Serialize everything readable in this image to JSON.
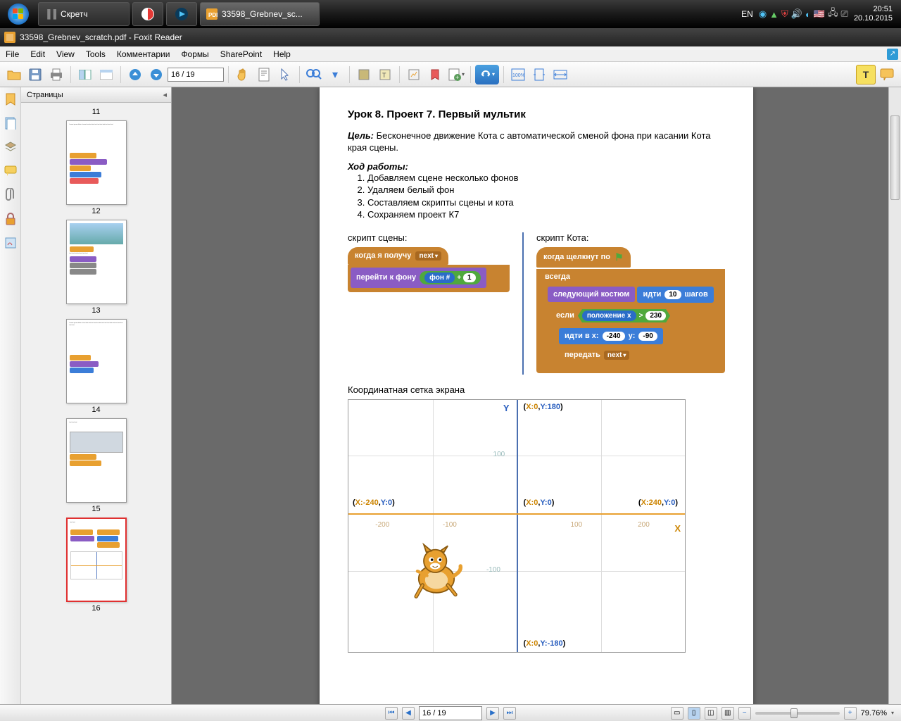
{
  "taskbar": {
    "items": [
      {
        "label": "Скретч"
      },
      {
        "label": ""
      },
      {
        "label": ""
      },
      {
        "label": "33598_Grebnev_sc..."
      }
    ],
    "lang": "EN",
    "time": "20:51",
    "date": "20.10.2015"
  },
  "window": {
    "title": "33598_Grebnev_scratch.pdf - Foxit Reader"
  },
  "menu": {
    "file": "File",
    "edit": "Edit",
    "view": "View",
    "tools": "Tools",
    "comments": "Комментарии",
    "forms": "Формы",
    "sharepoint": "SharePoint",
    "help": "Help"
  },
  "toolbar": {
    "page_top": "16 / 19",
    "page_bottom": "16 / 19"
  },
  "sidebar": {
    "header": "Страницы",
    "thumbs": [
      {
        "n": "11"
      },
      {
        "n": "12"
      },
      {
        "n": "13"
      },
      {
        "n": "14"
      },
      {
        "n": "15"
      },
      {
        "n": "16"
      }
    ]
  },
  "doc": {
    "title": "Урок 8. Проект 7. Первый мультик",
    "goal_label": "Цель:",
    "goal_text": "Бесконечное движение Кота с автоматической сменой фона при касании Кота края сцены.",
    "steps_label": "Ход работы:",
    "steps": [
      "Добавляем сцене несколько фонов",
      "Удаляем белый фон",
      "Составляем скрипты сцены и кота",
      "Сохраняем проект К7"
    ],
    "scene_label": "скрипт сцены:",
    "cat_label": "скрипт Кота:",
    "grid_label": "Координатная сетка экрана",
    "blocks": {
      "when_receive": "когда я получу",
      "next": "next",
      "goto_bg": "перейти к фону",
      "bg_num": "фон #",
      "plus": "+",
      "one": "1",
      "when_flag": "когда щелкнут по",
      "forever": "всегда",
      "next_costume": "следующий костюм",
      "move": "идти",
      "ten": "10",
      "steps_w": "шагов",
      "if": "если",
      "xpos": "положение x",
      "gt": ">",
      "v230": "230",
      "goto_xy": "идти в x:",
      "vx": "-240",
      "ylab": "y:",
      "vy": "-90",
      "broadcast": "передать"
    },
    "axes": {
      "X": "X",
      "Y": "Y",
      "tl": "(X:0,Y:180)",
      "left": "(X:-240,Y:0)",
      "center": "(X:0,Y:0)",
      "right": "(X:240,Y:0)",
      "bottom": "(X:0,Y:-180)",
      "t_n200": "-200",
      "t_n100": "-100",
      "t_100": "100",
      "t_200": "200",
      "ty_100": "100",
      "ty_n100": "-100"
    }
  },
  "status": {
    "zoom": "79.76%"
  }
}
